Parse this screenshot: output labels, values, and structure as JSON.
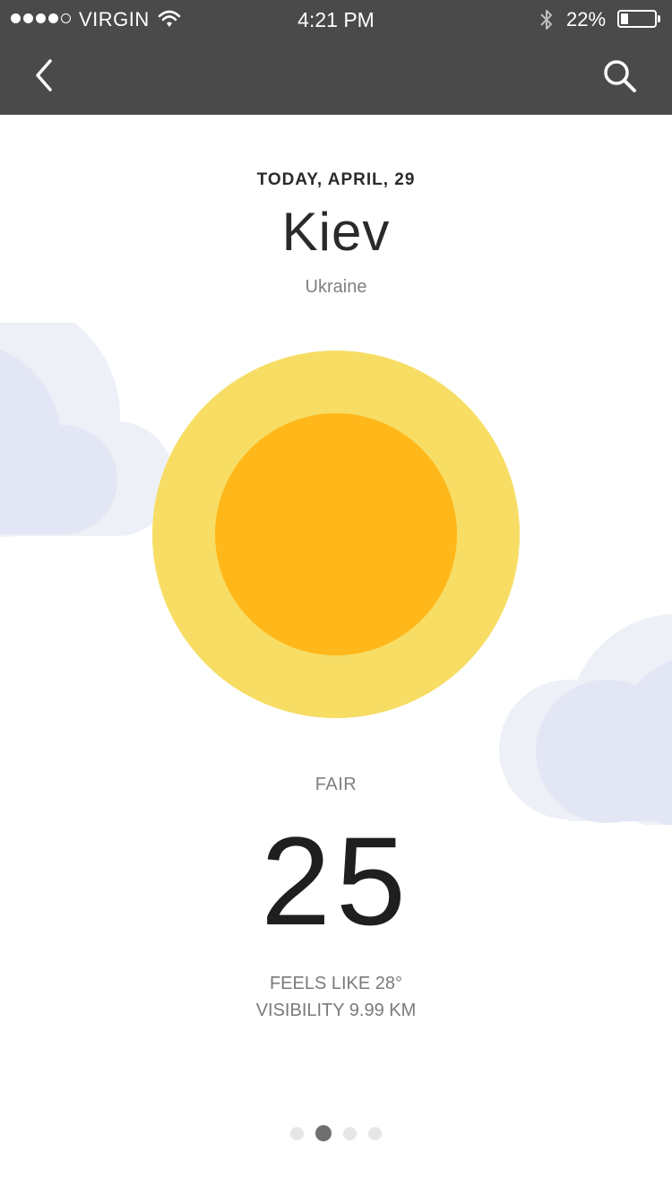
{
  "status_bar": {
    "carrier": "VIRGIN",
    "time": "4:21 PM",
    "battery": "22%",
    "battery_level": 0.22
  },
  "nav": {
    "back_icon": "chevron-left-icon",
    "search_icon": "search-icon"
  },
  "weather": {
    "date": "TODAY, APRIL, 29",
    "city": "Kiev",
    "country": "Ukraine",
    "condition": "FAIR",
    "temperature": "25",
    "feels_like": "FEELS LIKE 28°",
    "visibility": "VISIBILITY 9.99 KM"
  },
  "pager": {
    "count": 4,
    "active_index": 1
  },
  "colors": {
    "header_bg": "#4a4a4a",
    "sun_outer": "#f7dd64",
    "sun_inner": "#ffb71a",
    "cloud_light": "#edf0f7",
    "cloud_dark": "#e3e6f4"
  }
}
